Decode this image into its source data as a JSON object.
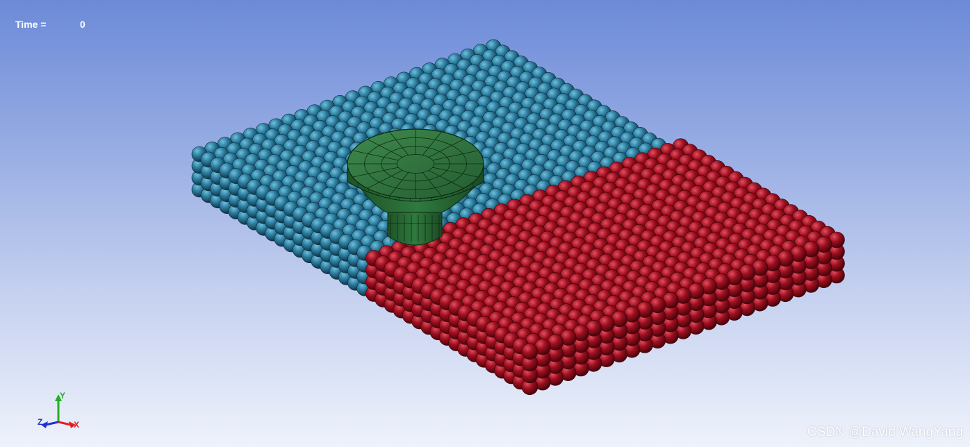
{
  "hud": {
    "time_label": "Time =",
    "time_value": "0"
  },
  "axis_triad": {
    "x_label": "X",
    "y_label": "Y",
    "z_label": "Z",
    "x_color": "#e02020",
    "y_color": "#20b020",
    "z_color": "#2030d0"
  },
  "scene": {
    "colors": {
      "blue_particles": "#2e7ea0",
      "red_particles": "#a01020",
      "tool": "#2e6e3a",
      "tool_mesh": "#0c2a12"
    }
  },
  "watermark": "CSDN @David WangYang"
}
